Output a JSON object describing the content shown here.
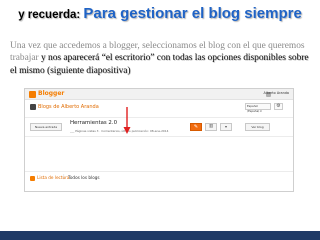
{
  "slide": {
    "title_prefix": "y recuerda: ",
    "title_main": "Para gestionar el blog siempre",
    "body_plain": "Una vez que accedemos a blogger, seleccionamos el blog con el que queremos trabajar ",
    "body_emph": "y nos aparecerá “el escritorio” con todas las opciones disponibles sobre el mismo (siguiente diapositiva)",
    "colors": {
      "title_main": "#1f63c6",
      "body_plain": "#8a8a8a",
      "bottom_bar": "#1f3a66",
      "arrow": "#e02020"
    }
  },
  "blogger": {
    "brand": "Blogger",
    "user_name": "Alberto Aranda",
    "blog_title": "Blogs de Alberto Aranda",
    "language_select": "Español (España) ▾",
    "gear_icon": "⚙",
    "new_post_label": "Nueva entrada",
    "post": {
      "title": "Herramientas 2.0",
      "page_views": "___ Páginas vistas",
      "page_views_count": "3",
      "sep": " · ",
      "comments": "Comentarios",
      "last_published": "último publicación: 08-ene-2014"
    },
    "edit_icon": "✎",
    "stats_icon": "▥",
    "menu_icon": "▾",
    "view_blog_label": "Ver blog",
    "reading_list_label": "Lista de lectura",
    "reading_sep": "|",
    "all_blogs_label": "Todos los blogs",
    "colors": {
      "brand": "#f57d00",
      "edit_button": "#f26c0f"
    }
  }
}
